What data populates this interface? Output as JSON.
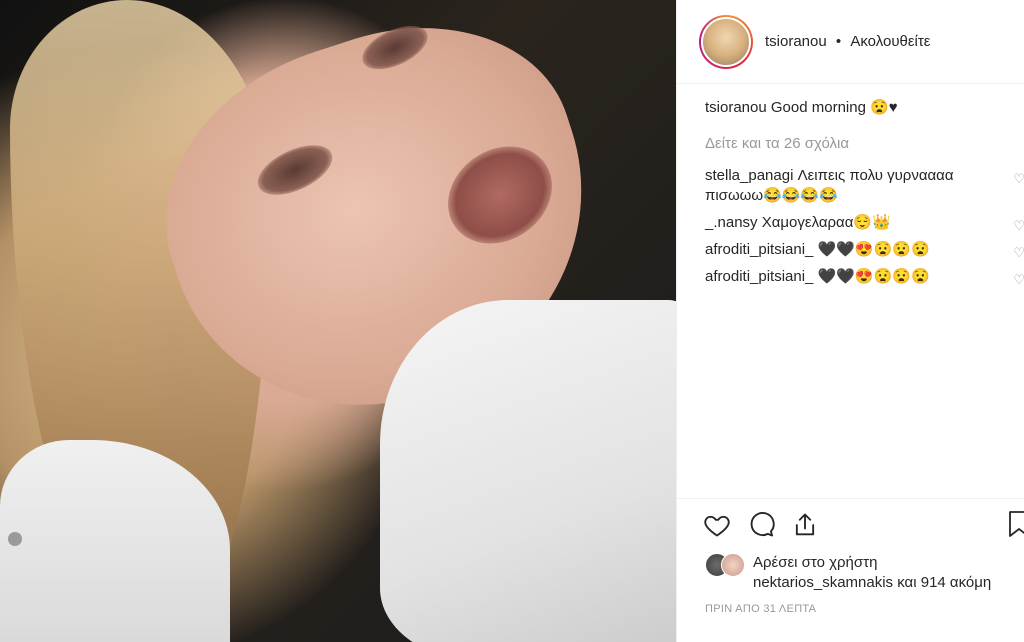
{
  "post": {
    "author": "tsioranou",
    "follow_status": "Ακολουθείτε",
    "separator": "•",
    "caption_text": "Good morning 😧♥",
    "view_all_comments": "Δείτε και τα 26 σχόλια",
    "comments": [
      {
        "user": "stella_panagi",
        "text": "Λειπεις πολυ γυρναααα πισωωω😂😂😂😂"
      },
      {
        "user": "_.nansy",
        "text": "Χαμογελαραα😌👑"
      },
      {
        "user": "afroditi_pitsiani_",
        "text": "🖤🖤😍😧😧😧"
      },
      {
        "user": "afroditi_pitsiani_",
        "text": "🖤🖤😍😧😧😧"
      }
    ],
    "likes_line1": "Αρέσει στο χρήστη",
    "likes_user": "nektarios_skamnakis",
    "likes_rest": "και 914 ακόμη",
    "timestamp": "ΠΡΙΝ ΑΠΟ 31 ΛΕΠΤΑ"
  },
  "colors": {
    "text": "#262626",
    "muted": "#999999",
    "border": "#efefef"
  }
}
